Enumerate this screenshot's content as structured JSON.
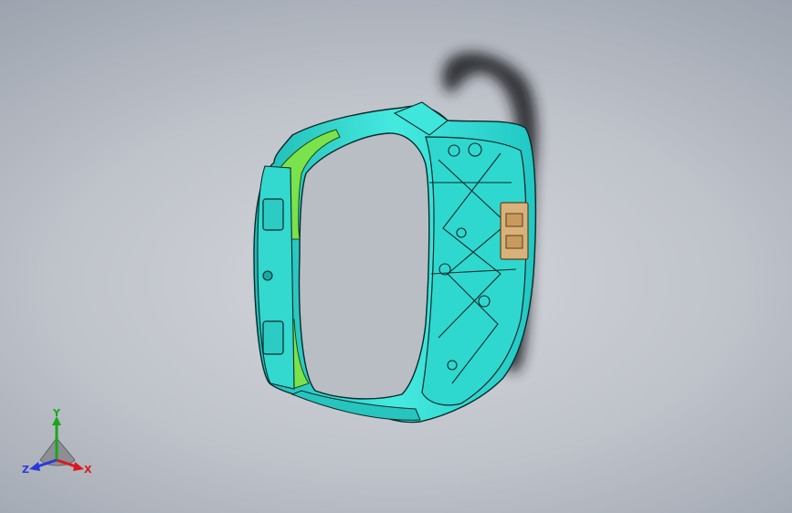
{
  "viewport": {
    "background_top": "#939aa6",
    "background_center": "#d3d6db"
  },
  "model": {
    "body_color": "#2fe0d6",
    "edge_color": "#0a2a2a",
    "highlight_color": "#6fe24a",
    "insert_color": "#d8b27a",
    "shadow_color": "#1b1c1f"
  },
  "triad": {
    "x_label": "X",
    "y_label": "Y",
    "z_label": "Z",
    "x_color": "#d81b1b",
    "y_color": "#18a818",
    "z_color": "#2a3ad8"
  }
}
